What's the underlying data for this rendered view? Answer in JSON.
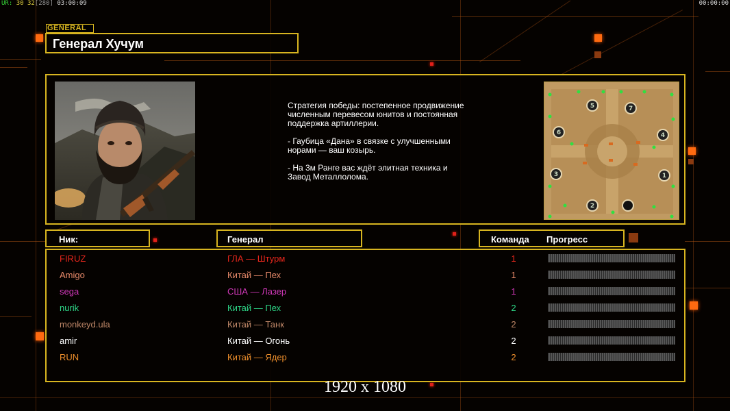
{
  "hud": {
    "ur_label": "UR:",
    "v1": "30",
    "v2": "32",
    "v3": "[280]",
    "timer_left": "03:00:09",
    "timer_right": "00:00:00"
  },
  "section_tag": "GENERAL",
  "general_name": "Генерал Хучум",
  "strategy": [
    "Стратегия победы: постепенное продвижение численным перевесом юнитов и постоянная поддержка артиллерии.",
    "- Гаубица «Дана» в связке с улучшенными норами — ваш козырь.",
    "- На 3м Ранге вас ждёт элитная техника и Завод Металлолома."
  ],
  "map_slots": [
    "5",
    "7",
    "6",
    "4",
    "3",
    "1",
    "2"
  ],
  "columns": {
    "nick": "Ник:",
    "general": "Генерал",
    "team": "Команда",
    "progress": "Прогресс"
  },
  "players": [
    {
      "nick": "FIRUZ",
      "general": "ГЛА — Штурм",
      "team": "1",
      "color": "#e8271c",
      "progress": 0
    },
    {
      "nick": "Amigo",
      "general": "Китай — Пех",
      "team": "1",
      "color": "#e88a6a",
      "progress": 0
    },
    {
      "nick": "sega",
      "general": "США — Лазер",
      "team": "1",
      "color": "#d038b8",
      "progress": 0
    },
    {
      "nick": "nurik",
      "general": "Китай — Пех",
      "team": "2",
      "color": "#2ed888",
      "progress": 0
    },
    {
      "nick": "monkeyd.ula",
      "general": "Китай — Танк",
      "team": "2",
      "color": "#c08868",
      "progress": 0
    },
    {
      "nick": "amir",
      "general": "Китай — Огонь",
      "team": "2",
      "color": "#ffffff",
      "progress": 0
    },
    {
      "nick": "RUN",
      "general": "Китай — Ядер",
      "team": "2",
      "color": "#f0902c",
      "progress": 0
    }
  ],
  "resolution": "1920 x 1080"
}
